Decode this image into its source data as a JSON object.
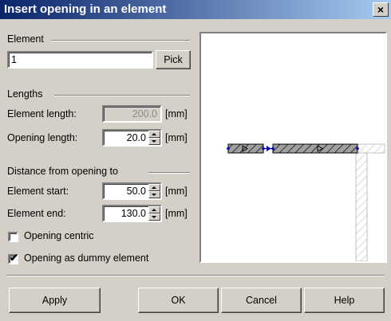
{
  "window": {
    "title": "Insert opening in an element",
    "close": "×"
  },
  "element": {
    "group_label": "Element",
    "value": "1",
    "pick_label": "Pick"
  },
  "lengths": {
    "group_label": "Lengths",
    "element_length_label": "Element length:",
    "element_length_value": "200.0",
    "element_length_unit": "[mm]",
    "opening_length_label": "Opening length:",
    "opening_length_value": "20.0",
    "opening_length_unit": "[mm]"
  },
  "distance": {
    "group_label": "Distance from opening to",
    "start_label": "Element start:",
    "start_value": "50.0",
    "start_unit": "[mm]",
    "end_label": "Element end:",
    "end_value": "130.0",
    "end_unit": "[mm]"
  },
  "options": {
    "centric_label": "Opening centric",
    "centric_checked": false,
    "dummy_label": "Opening as dummy element",
    "dummy_checked": true,
    "check_mark": "✔"
  },
  "buttons": {
    "apply": "Apply",
    "ok": "OK",
    "cancel": "Cancel",
    "help": "Help"
  }
}
